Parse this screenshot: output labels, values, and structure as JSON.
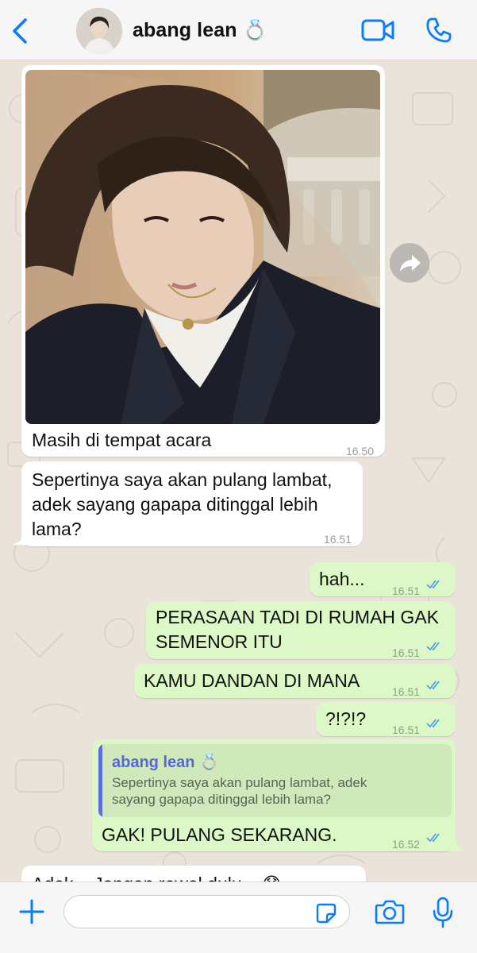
{
  "header": {
    "contact_name": "abang lean 💍"
  },
  "colors": {
    "accent": "#0a7cff",
    "incoming_bubble": "#ffffff",
    "outgoing_bubble": "#dcf8c6",
    "read_ticks": "#4fa3e3",
    "quote_name": "#5566d6"
  },
  "messages": [
    {
      "text": "Masih di tempat acara",
      "time": "16.50"
    },
    {
      "line1": "Sepertinya saya akan pulang lambat,",
      "line2": "adek sayang gapapa ditinggal lebih",
      "line3": "lama?",
      "time": "16.51"
    },
    {
      "text": "hah...",
      "time": "16.51"
    },
    {
      "line1": "PERASAAN TADI DI RUMAH GAK",
      "line2": "SEMENOR ITU",
      "time": "16.51"
    },
    {
      "text": "KAMU DANDAN DI MANA",
      "time": "16.51"
    },
    {
      "text": "?!?!?",
      "time": "16.51"
    },
    {
      "quote_name": "abang lean 💍",
      "quote_line1": "Sepertinya saya akan pulang lambat, adek",
      "quote_line2": "sayang gapapa ditinggal lebih lama?",
      "text": "GAK! PULANG SEKARANG.",
      "time": "16.52"
    },
    {
      "text": "Adek... Jangan rewel dulu... 😰"
    }
  ],
  "icons": {
    "back": "chevron-left-icon",
    "video": "video-call-icon",
    "phone": "phone-icon",
    "forward": "share-forward-icon",
    "add": "plus-icon",
    "sticker": "sticker-icon",
    "camera": "camera-icon",
    "mic": "microphone-icon"
  }
}
